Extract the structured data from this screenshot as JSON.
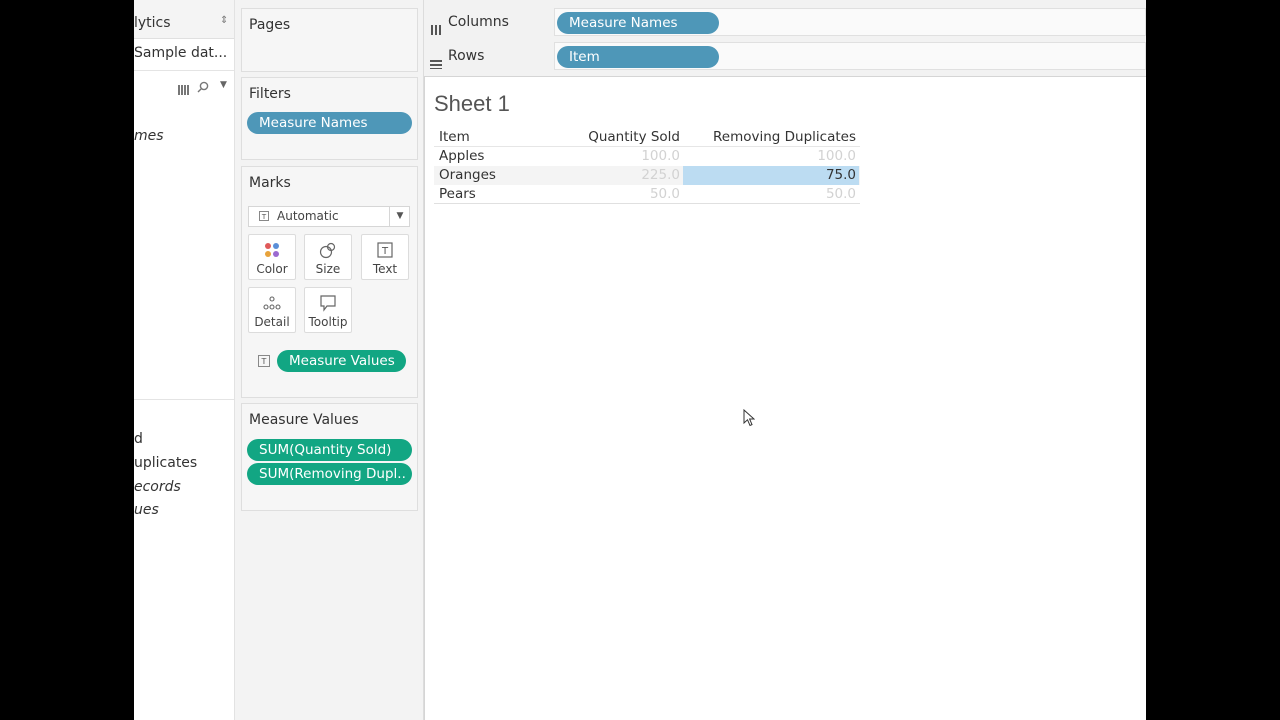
{
  "data_pane": {
    "tab_label": "lytics",
    "datasource": "Sample dat...",
    "items_top": [
      "mes"
    ],
    "items_bottom": [
      "d",
      "uplicates",
      "ecords",
      "ues"
    ]
  },
  "shelves": {
    "pages_label": "Pages",
    "filters_label": "Filters",
    "filters_pill": "Measure Names",
    "marks_label": "Marks",
    "marks_type": "Automatic",
    "marks_buttons": [
      "Color",
      "Size",
      "Text",
      "Detail",
      "Tooltip"
    ],
    "marks_pill": "Measure Values",
    "measure_values_label": "Measure Values",
    "measure_values_pills": [
      "SUM(Quantity Sold)",
      "SUM(Removing Dupl.."
    ],
    "columns_label": "Columns",
    "columns_pill": "Measure Names",
    "rows_label": "Rows",
    "rows_pill": "Item"
  },
  "sheet": {
    "title": "Sheet 1",
    "table": {
      "headers": [
        "Item",
        "Quantity Sold",
        "Removing Duplicates"
      ],
      "rows": [
        {
          "item": "Apples",
          "qty": "100.0",
          "dup": "100.0"
        },
        {
          "item": "Oranges",
          "qty": "225.0",
          "dup": "75.0"
        },
        {
          "item": "Pears",
          "qty": "50.0",
          "dup": "50.0"
        }
      ]
    }
  },
  "colors": {
    "pill_blue": "#4e97b8",
    "pill_green": "#12a683",
    "highlight": "#bcdcf2"
  }
}
